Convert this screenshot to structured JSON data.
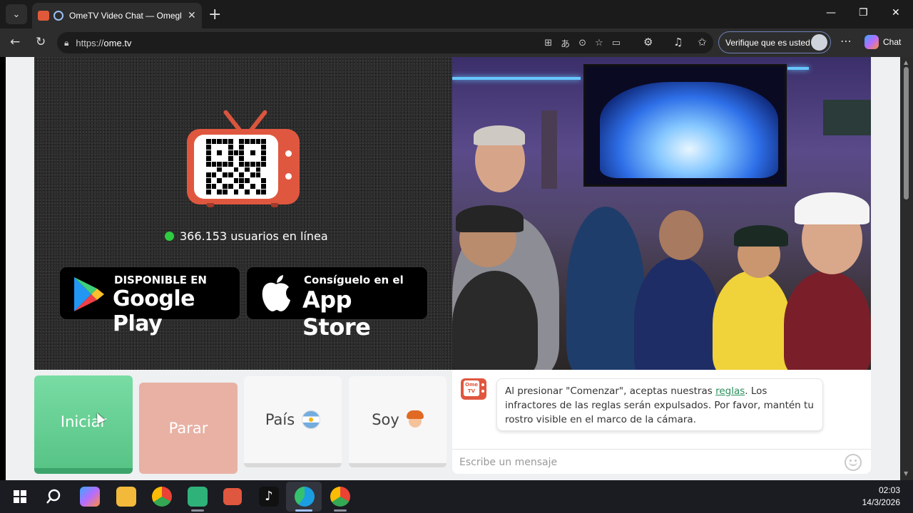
{
  "browser": {
    "tab_title": "OmeTV Video Chat — Omegl",
    "close_tab": "✕",
    "new_tab": "+",
    "url_scheme": "https://",
    "url_host": "ome.tv",
    "verify_label": "Verifique que es usted",
    "chat_label": "Chat",
    "window_controls": {
      "minimize": "—",
      "restore": "❐",
      "close": "✕"
    }
  },
  "promo": {
    "online_count_text": "366.153 usuarios en línea",
    "google_play": {
      "small": "DISPONIBLE EN",
      "big": "Google Play"
    },
    "app_store": {
      "small": "Consíguelo en el",
      "big": "App Store"
    }
  },
  "controls": {
    "start_label": "Iniciar",
    "stop_label": "Parar",
    "country_label": "País",
    "gender_label": "Soy"
  },
  "chat": {
    "logo_text": "Ome TV",
    "notice_before": "Al presionar \"Comenzar\", aceptas nuestras ",
    "notice_link": "reglas",
    "notice_after": ". Los infractores de las reglas serán expulsados. Por favor, mantén tu rostro visible en el marco de la cámara.",
    "input_placeholder": "Escribe un mensaje"
  },
  "taskbar": {
    "time": "02:03",
    "date": "14/3/2026"
  },
  "colors": {
    "start_green": "#5fcb8e",
    "stop_salmon": "#e8b1a4",
    "brand_red": "#e0573f",
    "online_dot": "#2ecc40"
  }
}
